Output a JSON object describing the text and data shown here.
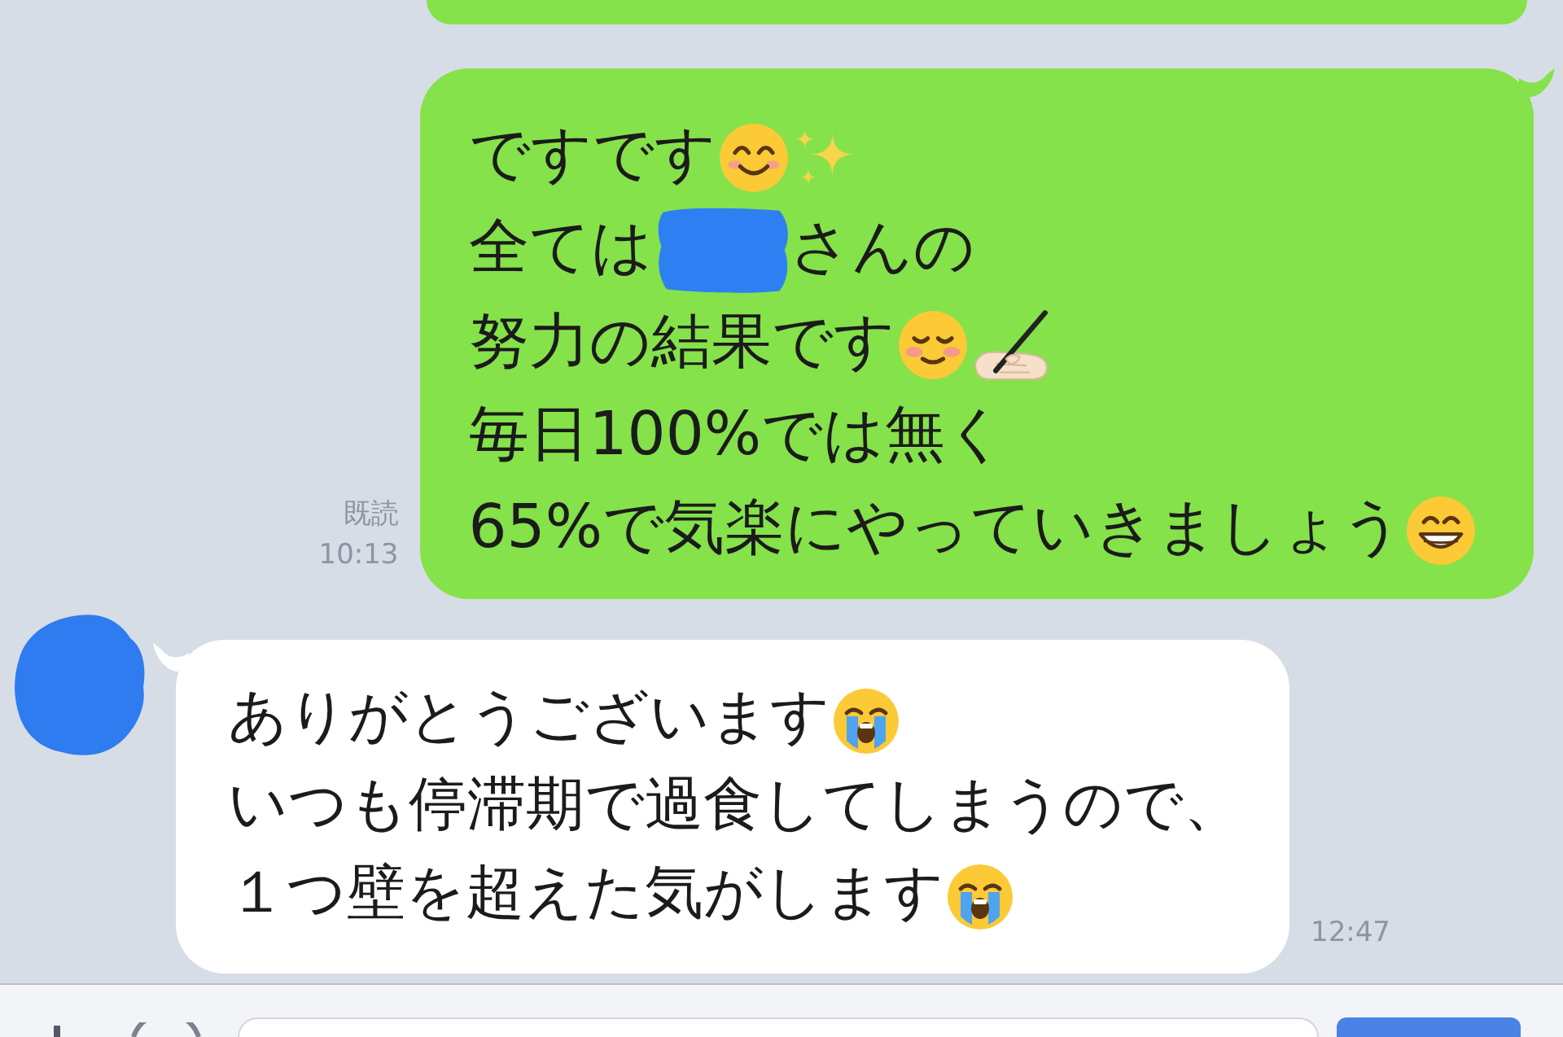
{
  "messages": [
    {
      "kind": "outgoing",
      "clipped": true
    },
    {
      "kind": "outgoing",
      "clipped": false,
      "read_label": "既読",
      "time": "10:13",
      "lines": [
        {
          "segments": [
            {
              "kind": "text",
              "text": "ですです"
            },
            {
              "kind": "smile"
            },
            {
              "kind": "sparkles"
            }
          ]
        },
        {
          "segments": [
            {
              "kind": "text",
              "text": "全ては"
            },
            {
              "kind": "redacted"
            },
            {
              "kind": "text",
              "text": "さんの"
            }
          ]
        },
        {
          "segments": [
            {
              "kind": "text",
              "text": "努力の結果です"
            },
            {
              "kind": "blush"
            },
            {
              "kind": "writing"
            }
          ]
        },
        {
          "segments": [
            {
              "kind": "text",
              "text": "毎日100%では無く"
            }
          ]
        },
        {
          "segments": [
            {
              "kind": "text",
              "text": "65%で気楽にやっていきましょう"
            },
            {
              "kind": "grin"
            }
          ]
        }
      ]
    },
    {
      "kind": "incoming",
      "clipped": false,
      "time": "12:47",
      "lines": [
        {
          "segments": [
            {
              "kind": "text",
              "text": "ありがとうございます"
            },
            {
              "kind": "crying"
            }
          ]
        },
        {
          "segments": [
            {
              "kind": "text",
              "text": "いつも停滞期で過食してしまうので、"
            }
          ]
        },
        {
          "segments": [
            {
              "kind": "text",
              "text": "１つ壁を超えた気がします"
            },
            {
              "kind": "crying"
            }
          ]
        }
      ]
    }
  ]
}
